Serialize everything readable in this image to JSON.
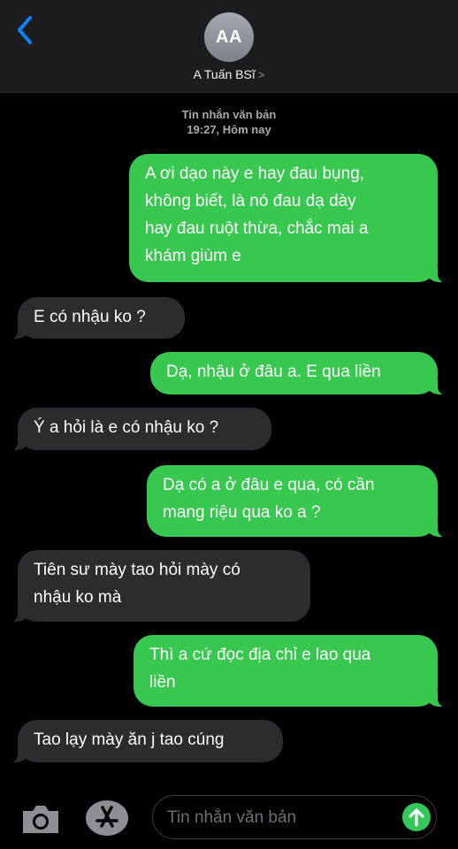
{
  "header": {
    "avatar_initials": "AA",
    "contact_name": "A Tuấn BSĩ",
    "chevron": ">"
  },
  "thread_meta": {
    "service": "Tin nhắn văn bản",
    "timestamp": "19:27, Hôm nay"
  },
  "messages": [
    {
      "direction": "outgoing",
      "text": "A ơi dạo này e hay đau bụng,\nkhông biết, là nó đau dạ dày\nhay đau ruột thừa, chắc mai a\nkhám giùm e"
    },
    {
      "direction": "incoming",
      "text": "E có nhậu ko ?"
    },
    {
      "direction": "outgoing",
      "text": "Dạ, nhậu ở đâu a. E qua liền"
    },
    {
      "direction": "incoming",
      "text": "Ý a hỏi là e có nhậu ko ?"
    },
    {
      "direction": "outgoing",
      "text": "Dạ có a ở đâu e qua, có cần\nmang riệu qua ko a ?"
    },
    {
      "direction": "incoming",
      "text": "Tiên sư mày tao hỏi mày có\nnhậu ko mà"
    },
    {
      "direction": "outgoing",
      "text": "Thì a cứ đọc địa chỉ e lao qua\nliền"
    },
    {
      "direction": "incoming",
      "text": "Tao lạy mày ăn j tao cúng"
    }
  ],
  "composer": {
    "placeholder": "Tin nhắn văn bản",
    "value": ""
  },
  "icons": {
    "back": "chevron-left-icon",
    "camera": "camera-icon",
    "apps": "app-store-icon",
    "send": "arrow-up-icon"
  },
  "colors": {
    "outgoing_bubble": "#39c84f",
    "incoming_bubble": "#2c2c2e",
    "accent": "#0a84ff",
    "background": "#000000"
  }
}
